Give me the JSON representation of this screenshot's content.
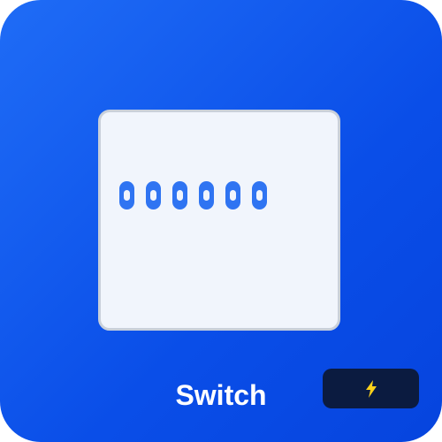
{
  "app": {
    "label": "Switch"
  },
  "device": {
    "port_count": 6
  },
  "icons": {
    "badge": "lightning-bolt-icon"
  },
  "colors": {
    "tile_background": "#0a4ee8",
    "panel_background": "#f1f5fc",
    "port": "#2f74f2",
    "badge_background": "#0b1b40",
    "bolt": "#ffd21a"
  }
}
